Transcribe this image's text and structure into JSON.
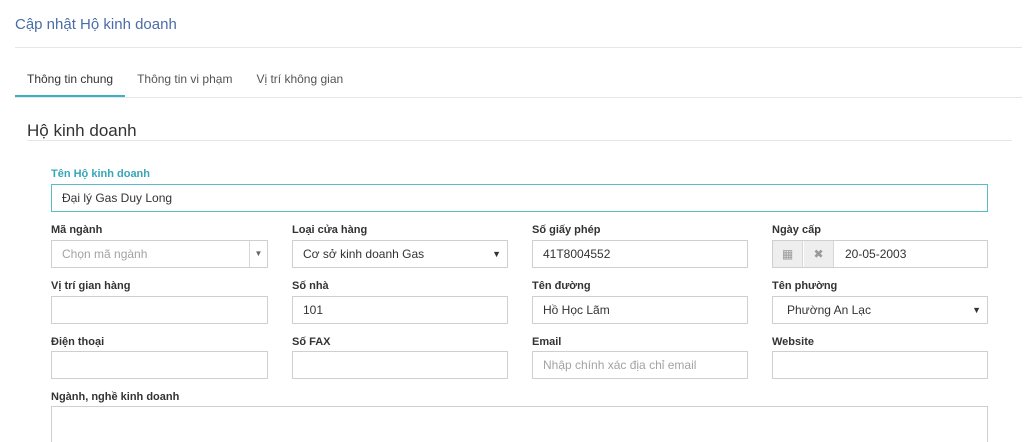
{
  "page": {
    "title": "Cập nhật Hộ kinh doanh"
  },
  "tabs": [
    {
      "label": "Thông tin chung",
      "active": true
    },
    {
      "label": "Thông tin vi phạm",
      "active": false
    },
    {
      "label": "Vị trí không gian",
      "active": false
    }
  ],
  "section": {
    "title": "Hộ kinh doanh"
  },
  "form": {
    "business_name": {
      "label": "Tên Hộ kinh doanh",
      "value": "Đại lý Gas Duy Long"
    },
    "industry_code": {
      "label": "Mã ngành",
      "placeholder": "Chọn mã ngành",
      "caret": "▼"
    },
    "store_type": {
      "label": "Loại cửa hàng",
      "value": "Cơ sở kinh doanh Gas",
      "caret": "▼"
    },
    "license_no": {
      "label": "Số giấy phép",
      "value": "41T8004552"
    },
    "issue_date": {
      "label": "Ngày cấp",
      "value": "20-05-2003",
      "calendar_icon": "▦",
      "clear_icon": "✖"
    },
    "booth_location": {
      "label": "Vị trí gian hàng",
      "value": ""
    },
    "house_no": {
      "label": "Số nhà",
      "value": "101"
    },
    "street": {
      "label": "Tên đường",
      "value": "Hồ Học Lãm"
    },
    "ward": {
      "label": "Tên phường",
      "value": "Phường An Lạc",
      "caret": "▼"
    },
    "phone": {
      "label": "Điện thoại",
      "value": ""
    },
    "fax": {
      "label": "Số FAX",
      "value": ""
    },
    "email": {
      "label": "Email",
      "placeholder": "Nhập chính xác địa chỉ email"
    },
    "website": {
      "label": "Website",
      "value": ""
    },
    "business_lines": {
      "label": "Ngành, nghề kinh doanh",
      "value": ""
    }
  },
  "colors": {
    "accent": "#36b3c6",
    "title": "#4a6da7",
    "label_accent": "#36a6b8"
  }
}
